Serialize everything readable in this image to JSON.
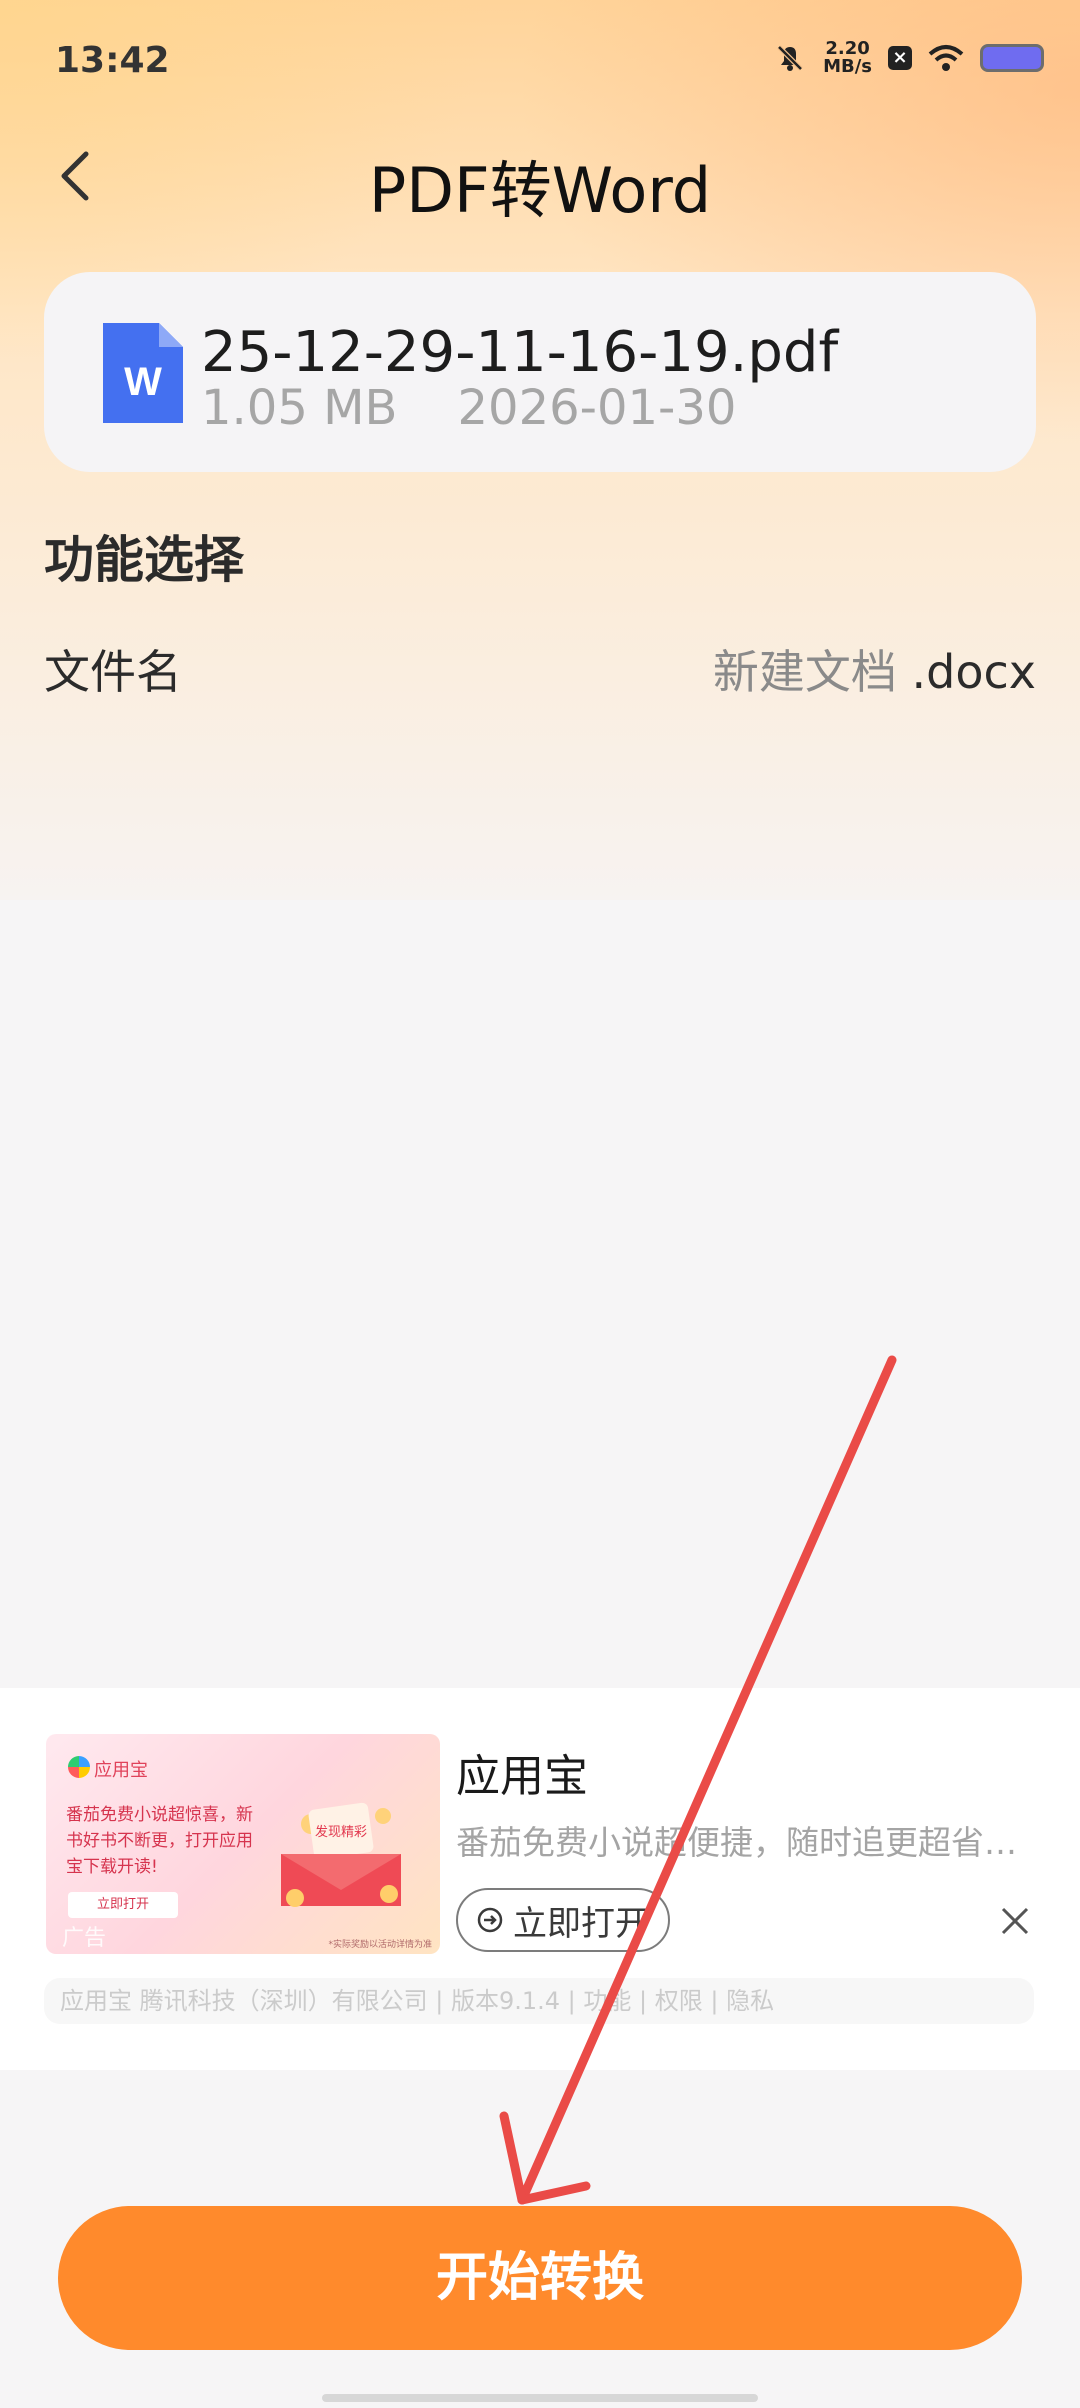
{
  "status_bar": {
    "time": "13:42",
    "net_speed_value": "2.20",
    "net_speed_unit": "MB/s"
  },
  "header": {
    "title": "PDF转Word"
  },
  "file": {
    "icon_letter": "W",
    "name": "25-12-29-11-16-19.pdf",
    "size": "1.05 MB",
    "date": "2026-01-30"
  },
  "section": {
    "title": "功能选择"
  },
  "filename_row": {
    "label": "文件名",
    "value": "新建文档",
    "extension": " .docx"
  },
  "ad": {
    "image": {
      "brand": "应用宝",
      "text": "番茄免费小说超惊喜，新书好书不断更，打开应用宝下载开读!",
      "button": "立即打开",
      "envelope_text": "发现精彩",
      "tag": "广告",
      "footnote": "*实际奖励以活动详情为准"
    },
    "title": "应用宝",
    "description": "番茄免费小说超便捷，随时追更超省…",
    "button_label": "立即打开",
    "footer": "应用宝 腾讯科技（深圳）有限公司 | 版本9.1.4 | 功能 | 权限 | 隐私"
  },
  "primary_button": {
    "label": "开始转换"
  },
  "colors": {
    "accent": "#ff8a2c",
    "word_icon": "#4470f0",
    "annotation_arrow": "#ea4b47"
  }
}
